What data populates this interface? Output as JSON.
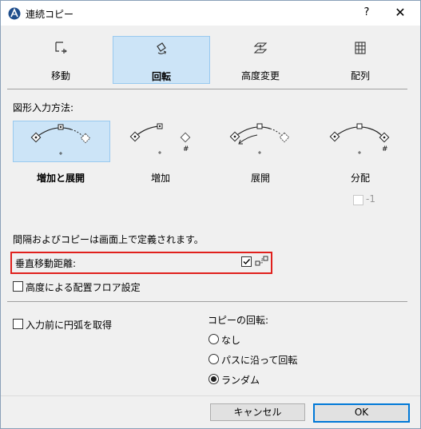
{
  "window": {
    "title": "連続コピー",
    "help": "?",
    "close": "✕"
  },
  "modes": [
    {
      "label": "移動",
      "selected": false,
      "icon": "move-icon"
    },
    {
      "label": "回転",
      "selected": true,
      "icon": "rotate-icon"
    },
    {
      "label": "高度変更",
      "selected": false,
      "icon": "elevate-icon"
    },
    {
      "label": "配列",
      "selected": false,
      "icon": "grid-icon"
    }
  ],
  "input_method": {
    "heading": "図形入力方法:",
    "options": [
      {
        "label": "増加と展開",
        "selected": true
      },
      {
        "label": "増加",
        "selected": false
      },
      {
        "label": "展開",
        "selected": false
      },
      {
        "label": "分配",
        "selected": false
      }
    ],
    "minus_one_label": "-1"
  },
  "info_text": "間隔およびコピーは画面上で定義されます。",
  "vertical_distance": {
    "label": "垂直移動距離:",
    "checked": true
  },
  "floor_by_elevation": {
    "label": "高度による配置フロア設定",
    "checked": false
  },
  "get_arc_before_input": {
    "label": "入力前に円弧を取得",
    "checked": false
  },
  "copy_rotation": {
    "heading": "コピーの回転:",
    "options": [
      {
        "label": "なし",
        "selected": false
      },
      {
        "label": "パスに沿って回転",
        "selected": false
      },
      {
        "label": "ランダム",
        "selected": true
      }
    ]
  },
  "buttons": {
    "cancel": "キャンセル",
    "ok": "OK"
  },
  "colors": {
    "selection_bg": "#cce4f7",
    "selection_border": "#99c9ef",
    "highlight_red": "#e0201c",
    "ok_border": "#0078d7"
  }
}
